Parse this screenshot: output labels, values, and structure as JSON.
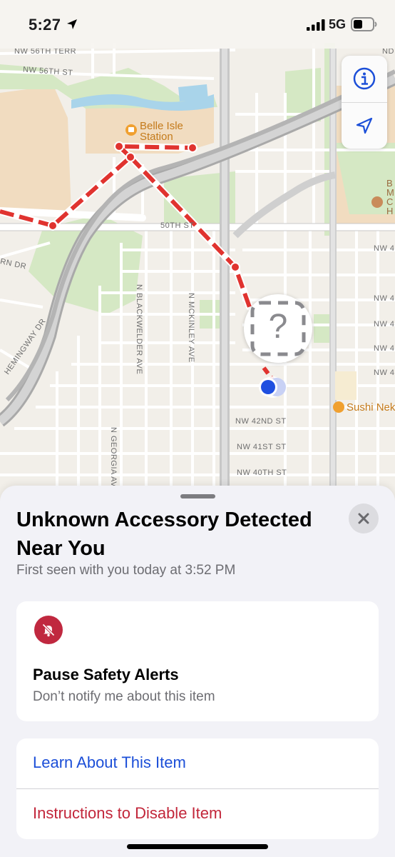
{
  "status_bar": {
    "time": "5:27",
    "network": "5G",
    "icons": [
      "location-arrow-icon",
      "cellular-signal-icon",
      "battery-icon"
    ]
  },
  "map": {
    "street_labels": {
      "nw56th_terr": "NW 56TH TERR",
      "nw56th_st": "NW 56TH ST",
      "fiftieth_st": "50TH ST",
      "rn_dr": "RN DR",
      "hemingway_dr": "HEMINGWAY DR",
      "blackwelder": "N BLACKWELDER AVE",
      "mckinley": "N MCKINLEY AVE",
      "georgia": "N GEORGIA AVE",
      "nw42": "NW 42ND ST",
      "nw41": "NW 41ST ST",
      "nw40": "NW 40TH ST",
      "nw4_a": "NW 4",
      "nw4_b": "NW 4",
      "nw4_c": "NW 4",
      "nw4_d": "NW 4",
      "nw4_e": "NW 4",
      "nd": "ND"
    },
    "pois": {
      "belle_isle": "Belle Isle\nStation",
      "sushi": "Sushi Nek",
      "museum": "B   \nM\nC\nH"
    },
    "accessory_marker_symbol": "?",
    "controls": {
      "info_icon": "info-icon",
      "location_icon": "location-arrow-icon"
    },
    "colors": {
      "route": "#e0332f",
      "user_dot": "#1f4fe0",
      "park": "#d5e8c4",
      "water": "#a9d4ea"
    }
  },
  "sheet": {
    "title": "Unknown Accessory Detected Near You",
    "subtitle": "First seen with you today at 3:52 PM",
    "pause_card": {
      "icon": "bell-slash-icon",
      "title": "Pause Safety Alerts",
      "description": "Don’t notify me about this item"
    },
    "links": {
      "learn": "Learn About This Item",
      "disable": "Instructions to Disable Item"
    },
    "colors": {
      "link_blue": "#1c4fd8",
      "link_red": "#c2263a",
      "pause_red": "#c0283f"
    }
  }
}
